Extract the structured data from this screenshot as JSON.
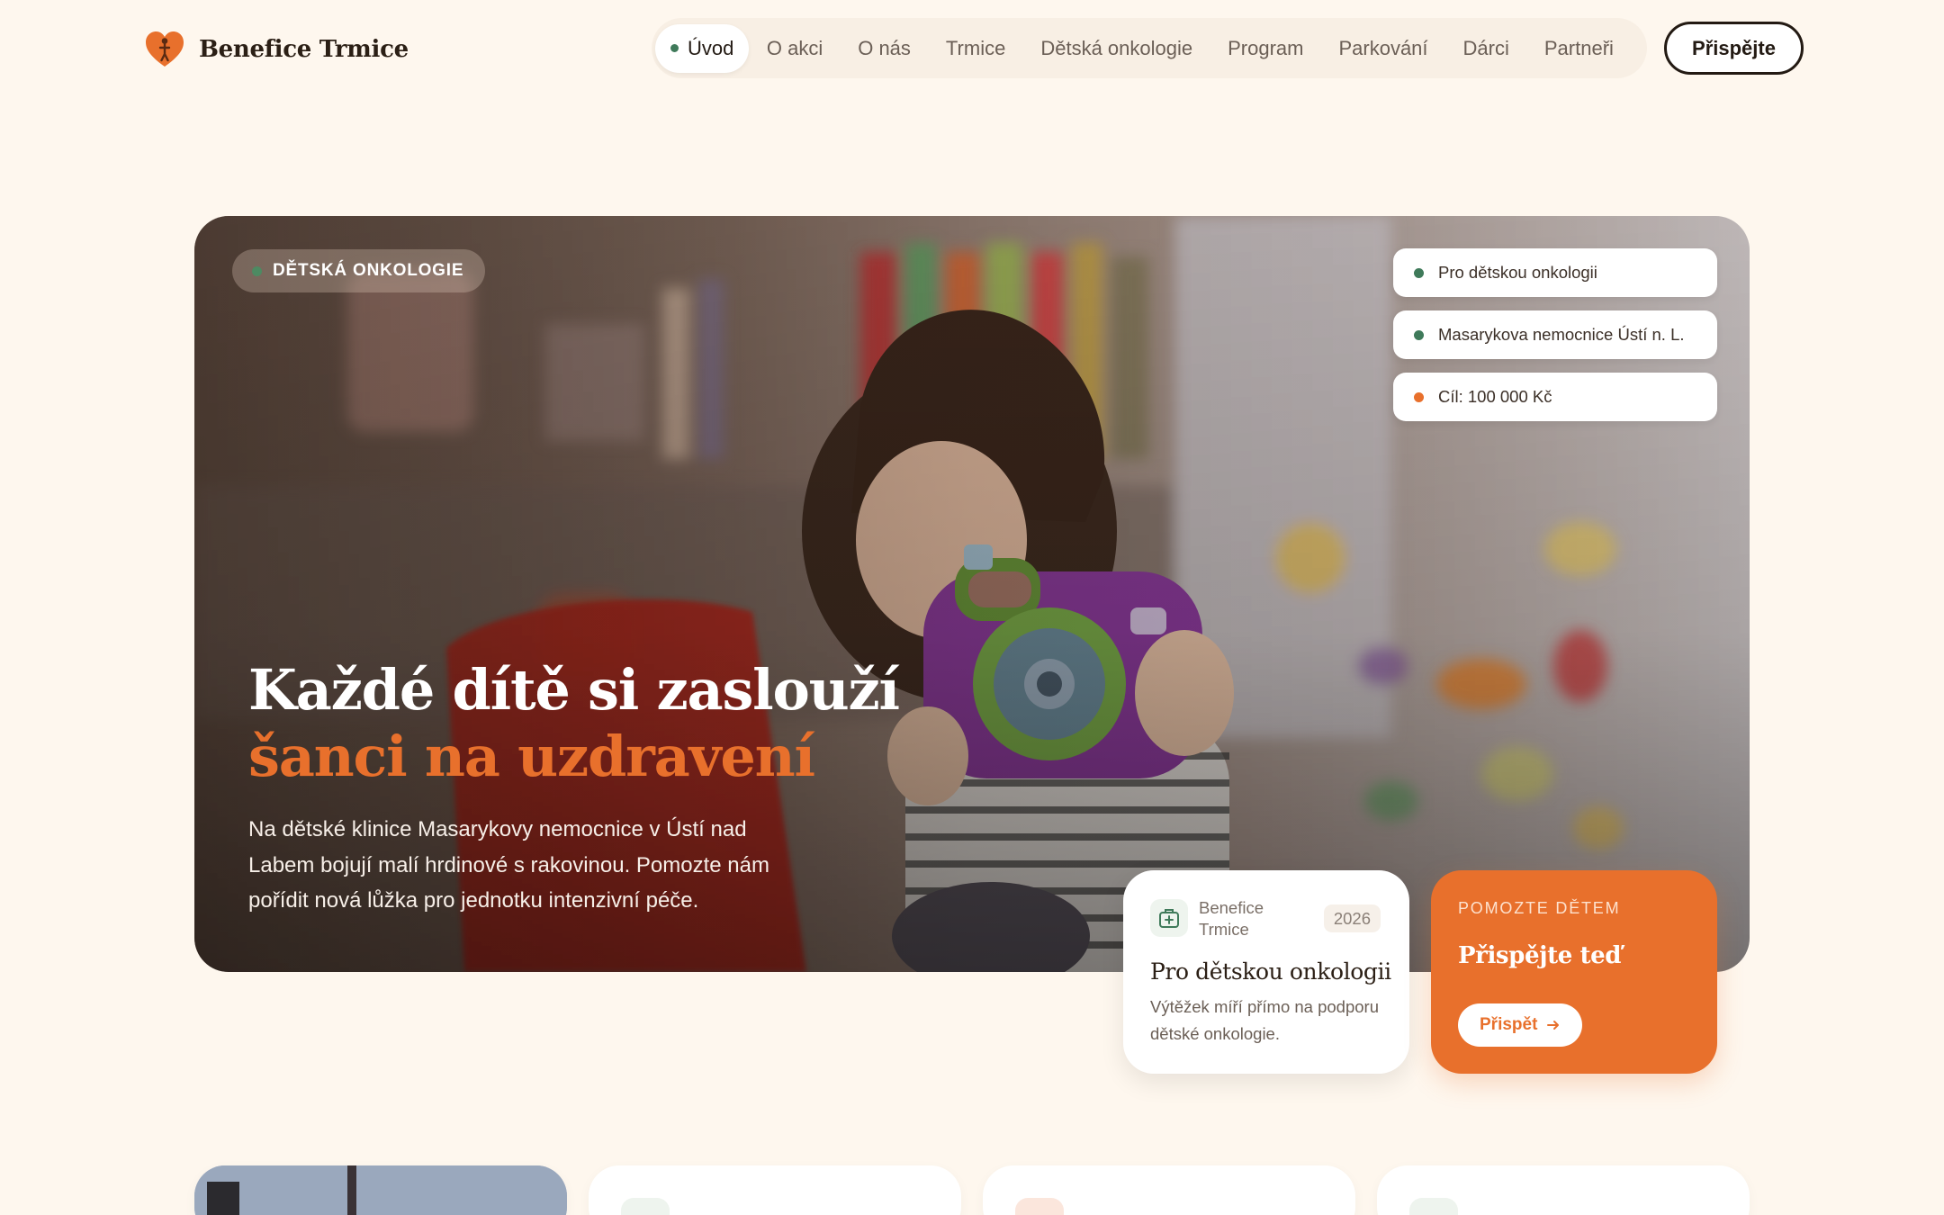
{
  "header": {
    "brand": "Benefice Trmice",
    "nav": [
      "Úvod",
      "O akci",
      "O nás",
      "Trmice",
      "Dětská onkologie",
      "Program",
      "Parkování",
      "Dárci",
      "Partneři"
    ],
    "active_nav": "Úvod",
    "cta_label": "Přispějte"
  },
  "hero": {
    "badge": "DĚTSKÁ ONKOLOGIE",
    "pills": [
      {
        "label": "Pro dětskou onkologii",
        "dot_color": "#3f7a5a"
      },
      {
        "label": "Masarykova nemocnice Ústí n. L.",
        "dot_color": "#3f7a5a"
      },
      {
        "label": "Cíl: 100 000 Kč",
        "dot_color": "#e8702c"
      }
    ],
    "headline_line1": "Každé dítě si zaslouží",
    "headline_line2": "šanci na uzdravení",
    "lead": "Na dětské klinice Masarykovy nemocnice v Ústí nad Labem bojují malí hrdinové s rakovinou. Pomozte nám pořídit nová lůžka pro jednotku intenzivní péče."
  },
  "info_card": {
    "org": "Benefice Trmice",
    "year": "2026",
    "title": "Pro dětskou onkologii",
    "text": "Výtěžek míří přímo na podporu dětské onkologie."
  },
  "donate_card": {
    "eyebrow": "POMOZTE DĚTEM",
    "title": "Přispějte teď",
    "button": "Přispět"
  },
  "colors": {
    "accent": "#e8702c",
    "green": "#3f7a5a",
    "background": "#fef7ee",
    "dark": "#231a13"
  }
}
